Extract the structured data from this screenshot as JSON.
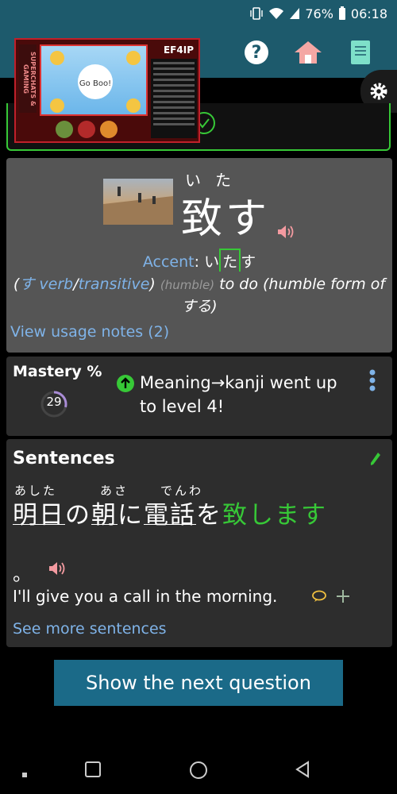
{
  "status_bar": {
    "battery": "76%",
    "time": "06:18"
  },
  "header": {
    "help_icon": "question-circle-icon",
    "home_icon": "home-icon",
    "book_icon": "book-icon",
    "settings_icon": "gear-icon"
  },
  "overlay": {
    "logo": "EF4IP",
    "side_text": "SUPERCHATS & GAMING",
    "game_text": "Go Boo!"
  },
  "word": {
    "furigana": "いた",
    "kanji": "致す",
    "accent_label": "Accent",
    "accent_pre": "い",
    "accent_marked": "た",
    "accent_post": "す",
    "pos_open": "(",
    "pos_kana": "す",
    "pos_verb": " verb",
    "pos_sep": "/",
    "pos_trans": "transitive",
    "pos_close": ")",
    "register": "(humble)",
    "definition": "to do (humble form of する)",
    "usage_link": "View usage notes (2)"
  },
  "mastery": {
    "title": "Mastery %",
    "value": "29",
    "percent": 29,
    "message": "Meaning→kanji went up to level 4!"
  },
  "sentences": {
    "title": "Sentences",
    "furigana_1": "あした",
    "furigana_2": "あさ",
    "furigana_3": "でんわ",
    "part_1": "明日",
    "part_2": "の",
    "part_3": "朝",
    "part_4": "に",
    "part_5": "電話",
    "part_6": "を",
    "part_highlight": "致します",
    "period": "。",
    "english": "I'll give you a call in the morning.",
    "more_link": "See more sentences"
  },
  "next_button": {
    "label": "Show the next question"
  },
  "colors": {
    "header": "#1d5a6c",
    "accent_green": "#37c837",
    "link_blue": "#7fb3e8",
    "button": "#1b6a88"
  }
}
